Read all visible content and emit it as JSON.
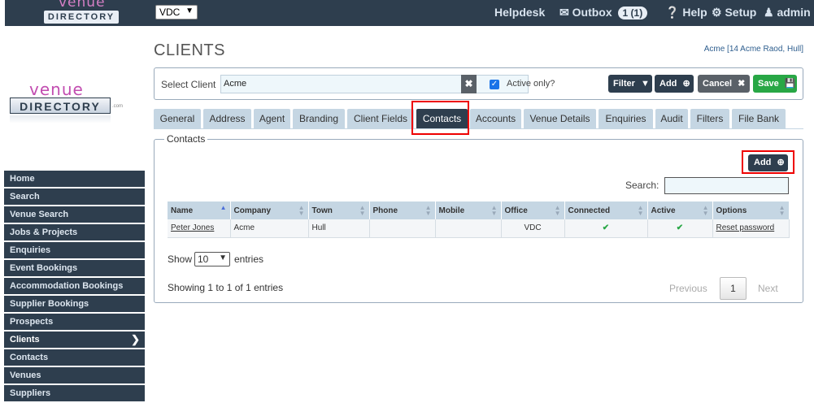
{
  "topbar": {
    "logo_top": "venue",
    "logo_bottom": "DIRECTORY",
    "company_select": "VDC",
    "helpdesk": "Helpdesk",
    "outbox": "Outbox",
    "outbox_badge": "1 (1)",
    "help": "Help",
    "setup": "Setup",
    "user": "admin"
  },
  "side_logo": {
    "top": "venue",
    "bottom": "DIRECTORY",
    "suffix": ".com"
  },
  "sidebar": {
    "items": [
      {
        "label": "Home"
      },
      {
        "label": "Search"
      },
      {
        "label": "Venue Search"
      },
      {
        "label": "Jobs & Projects"
      },
      {
        "label": "Enquiries"
      },
      {
        "label": "Event Bookings"
      },
      {
        "label": "Accommodation Bookings"
      },
      {
        "label": "Supplier Bookings"
      },
      {
        "label": "Prospects"
      },
      {
        "label": "Clients"
      },
      {
        "label": "Contacts"
      },
      {
        "label": "Venues"
      },
      {
        "label": "Suppliers"
      }
    ]
  },
  "page": {
    "title": "CLIENTS",
    "client_address": "Acme [14 Acme Raod, Hull]"
  },
  "client_bar": {
    "select_label": "Select Client",
    "client_value": "Acme",
    "active_only_label": "Active only?",
    "filter_label": "Filter",
    "add_label": "Add",
    "cancel_label": "Cancel",
    "save_label": "Save"
  },
  "tabs": [
    {
      "label": "General"
    },
    {
      "label": "Address"
    },
    {
      "label": "Agent"
    },
    {
      "label": "Branding"
    },
    {
      "label": "Client Fields"
    },
    {
      "label": "Contacts"
    },
    {
      "label": "Accounts"
    },
    {
      "label": "Venue Details"
    },
    {
      "label": "Enquiries"
    },
    {
      "label": "Audit"
    },
    {
      "label": "Filters"
    },
    {
      "label": "File Bank"
    }
  ],
  "contacts": {
    "legend": "Contacts",
    "add_label": "Add",
    "search_label": "Search:",
    "columns": [
      "Name",
      "Company",
      "Town",
      "Phone",
      "Mobile",
      "Office",
      "Connected",
      "Active",
      "Options"
    ],
    "rows": [
      {
        "name": "Peter Jones",
        "company": "Acme",
        "town": "Hull",
        "phone": "",
        "mobile": "",
        "office": "VDC",
        "connected": "✔",
        "active": "✔",
        "options": "Reset password"
      }
    ],
    "show_label": "Show",
    "page_size": "10",
    "entries_label": "entries",
    "showing": "Showing 1 to 1 of 1 entries",
    "previous": "Previous",
    "page": "1",
    "next": "Next"
  }
}
